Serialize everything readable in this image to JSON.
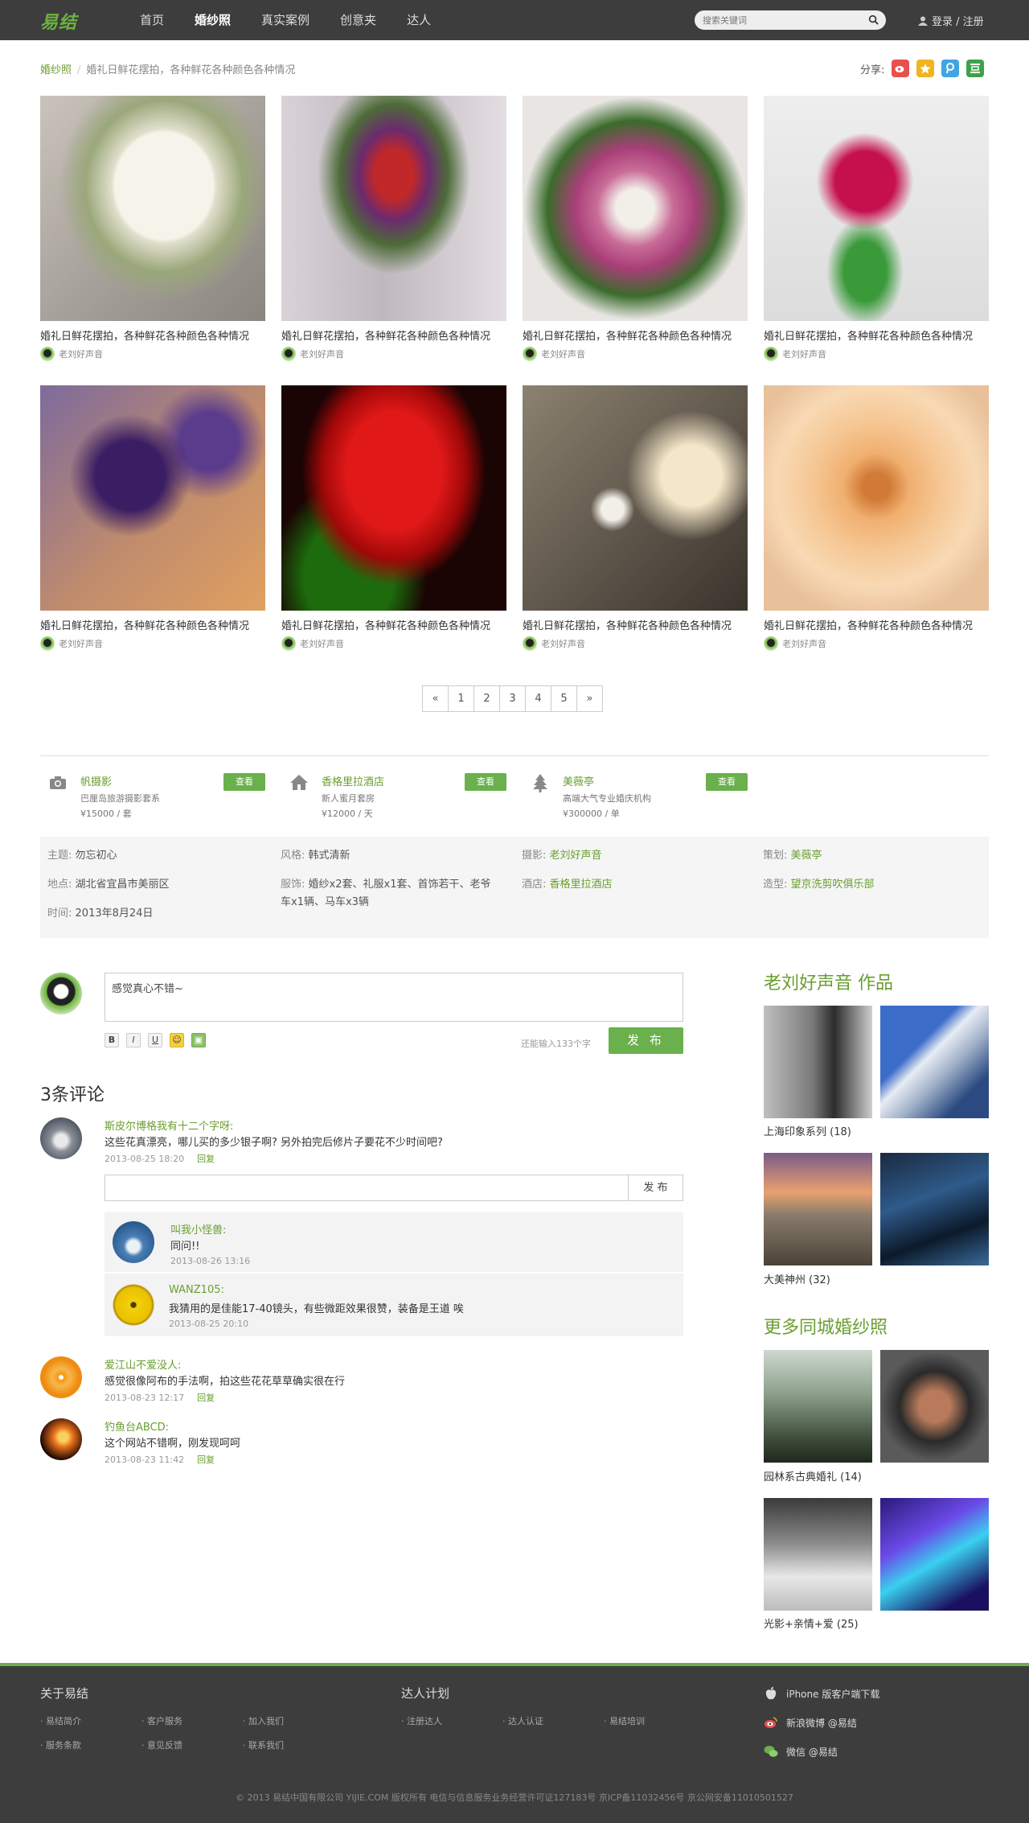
{
  "header": {
    "logo": "易结",
    "nav": [
      "首页",
      "婚纱照",
      "真实案例",
      "创意夹",
      "达人"
    ],
    "search_placeholder": "搜索关键词",
    "login": "登录 / 注册"
  },
  "breadcrumb": {
    "home": "婚纱照",
    "current": "婚礼日鲜花摆拍，各种鲜花各种颜色各种情况"
  },
  "share": {
    "label": "分享:",
    "icons": [
      "weibo-icon",
      "qzone-icon",
      "tencent-icon",
      "douban-icon"
    ]
  },
  "photos": [
    {
      "caption": "婚礼日鲜花摆拍，各种鲜花各种颜色各种情况",
      "author": "老刘好声音"
    },
    {
      "caption": "婚礼日鲜花摆拍，各种鲜花各种颜色各种情况",
      "author": "老刘好声音"
    },
    {
      "caption": "婚礼日鲜花摆拍，各种鲜花各种颜色各种情况",
      "author": "老刘好声音"
    },
    {
      "caption": "婚礼日鲜花摆拍，各种鲜花各种颜色各种情况",
      "author": "老刘好声音"
    },
    {
      "caption": "婚礼日鲜花摆拍，各种鲜花各种颜色各种情况",
      "author": "老刘好声音"
    },
    {
      "caption": "婚礼日鲜花摆拍，各种鲜花各种颜色各种情况",
      "author": "老刘好声音"
    },
    {
      "caption": "婚礼日鲜花摆拍，各种鲜花各种颜色各种情况",
      "author": "老刘好声音"
    },
    {
      "caption": "婚礼日鲜花摆拍，各种鲜花各种颜色各种情况",
      "author": "老刘好声音"
    }
  ],
  "pagination": [
    "«",
    "1",
    "2",
    "3",
    "4",
    "5",
    "»"
  ],
  "vendors": [
    {
      "name": "帆摄影",
      "desc": "巴厘岛旅游摄影套系",
      "price": "¥15000 / 套",
      "button": "查看",
      "icon": "camera-icon"
    },
    {
      "name": "香格里拉酒店",
      "desc": "新人蜜月套房",
      "price": "¥12000 / 天",
      "button": "查看",
      "icon": "home-icon"
    },
    {
      "name": "美薇亭",
      "desc": "高端大气专业婚庆机构",
      "price": "¥300000 / 单",
      "button": "查看",
      "icon": "tree-icon"
    }
  ],
  "info": {
    "theme": {
      "k": "主题:",
      "v": "勿忘初心"
    },
    "style": {
      "k": "风格:",
      "v": "韩式清新"
    },
    "photo": {
      "k": "摄影:",
      "v": "老刘好声音"
    },
    "plan": {
      "k": "策划:",
      "v": "美薇亭"
    },
    "place": {
      "k": "地点:",
      "v": "湖北省宜昌市美丽区"
    },
    "dress": {
      "k": "服饰:",
      "v1": "婚纱x2套、礼服x1套、首饰若干、老爷",
      "v2": "车x1辆、马车x3辆"
    },
    "hotel": {
      "k": "酒店:",
      "v": "香格里拉酒店"
    },
    "makeup": {
      "k": "造型:",
      "v": "望京洗剪吹俱乐部"
    },
    "time": {
      "k": "时间:",
      "v": "2013年8月24日"
    }
  },
  "composer": {
    "text": "感觉真心不错~",
    "tools": [
      "B",
      "I",
      "U",
      "☺",
      "▣"
    ],
    "remaining": "还能输入133个字",
    "publish": "发 布"
  },
  "comments_title": "3条评论",
  "comments": [
    {
      "name": "斯皮尔博格我有十二个字呀:",
      "text": "这些花真漂亮，哪儿买的多少银子啊? 另外拍完后修片子要花不少时间吧?",
      "date": "2013-08-25 18:20",
      "reply": "回复"
    },
    {
      "name": "爱江山不爱没人:",
      "text": "感觉很像阿布的手法啊，拍这些花花草草确实很在行",
      "date": "2013-08-23 12:17",
      "reply": "回复"
    },
    {
      "name": "钓鱼台ABCD:",
      "text": "这个网站不错啊，刚发现呵呵",
      "date": "2013-08-23 11:42",
      "reply": "回复"
    }
  ],
  "reply_box": {
    "button": "发 布"
  },
  "sub_comments": [
    {
      "name": "叫我小怪兽:",
      "text": "同问!!",
      "date": "2013-08-26 13:16"
    },
    {
      "name": "WANZ105:",
      "text": "我猜用的是佳能17-40镜头，有些微距效果很赞，装备是王道 唉",
      "date": "2013-08-25 20:10"
    }
  ],
  "sidebar": {
    "works_title": "老刘好声音 作品",
    "works": [
      {
        "label": "上海印象系列 (18)"
      },
      {
        "label": "大美神州 (32)"
      }
    ],
    "more_title": "更多同城婚纱照",
    "more": [
      {
        "label": "园林系古典婚礼 (14)"
      },
      {
        "label": "光影+亲情+爱 (25)"
      }
    ]
  },
  "footer": {
    "about_title": "关于易结",
    "about_links": [
      "· 易结简介",
      "· 客户服务",
      "· 加入我们",
      "· 服务条款",
      "· 意见反馈",
      "· 联系我们"
    ],
    "talent_title": "达人计划",
    "talent_links": [
      "· 注册达人",
      "· 达人认证",
      "· 易结培训"
    ],
    "apps": [
      "iPhone 版客户端下载",
      "新浪微博 @易结",
      "微信 @易结"
    ],
    "copyright": "© 2013  易结中国有限公司 YIJIE.COM  版权所有    电信与信息服务业务经营许可证127183号    京ICP备11032456号    京公网安备11010501527"
  }
}
